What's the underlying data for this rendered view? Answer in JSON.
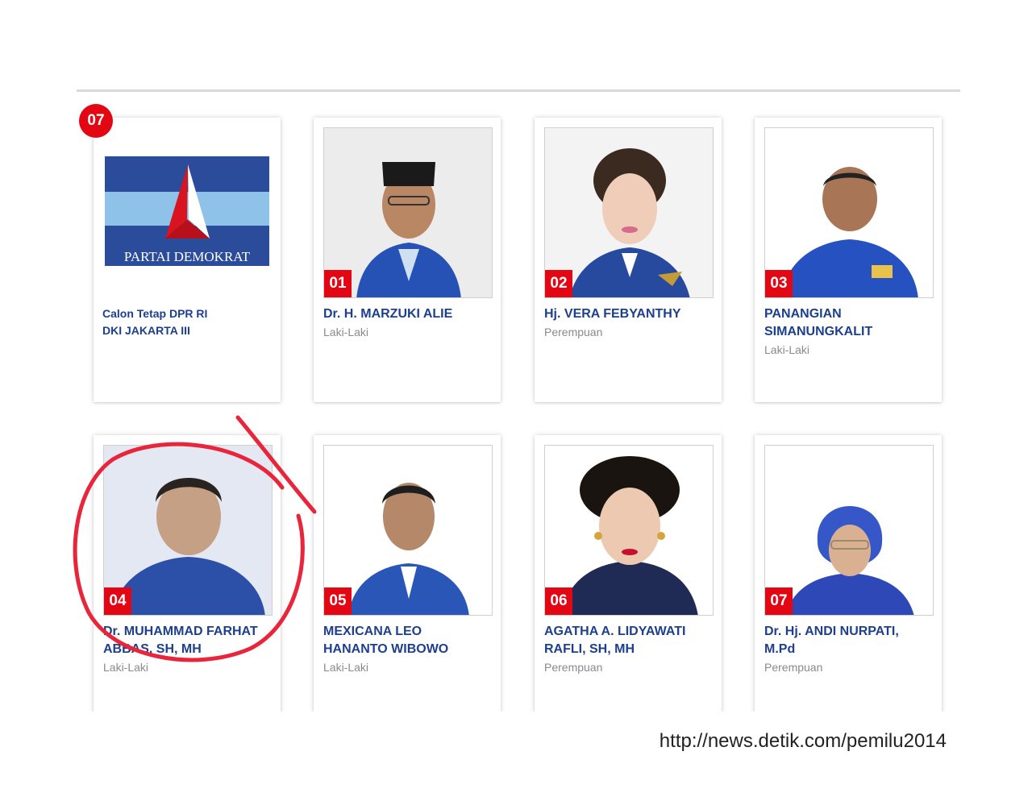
{
  "party": {
    "badge_number": "07",
    "logo_text": "PARTAI DEMOKRAT",
    "title_line1": "Calon Tetap DPR RI",
    "title_line2": "DKI JAKARTA III"
  },
  "candidates": [
    {
      "number": "01",
      "name_line1": "Dr. H. MARZUKI ALIE",
      "name_line2": "",
      "gender": "Laki-Laki"
    },
    {
      "number": "02",
      "name_line1": "Hj. VERA FEBYANTHY",
      "name_line2": "",
      "gender": "Perempuan"
    },
    {
      "number": "03",
      "name_line1": "PANANGIAN",
      "name_line2": "SIMANUNGKALIT",
      "gender": "Laki-Laki"
    },
    {
      "number": "04",
      "name_line1": "Dr. MUHAMMAD FARHAT",
      "name_line2": "ABBAS, SH, MH",
      "gender": "Laki-Laki"
    },
    {
      "number": "05",
      "name_line1": "MEXICANA LEO",
      "name_line2": "HANANTO WIBOWO",
      "gender": "Laki-Laki"
    },
    {
      "number": "06",
      "name_line1": "AGATHA A. LIDYAWATI",
      "name_line2": "RAFLI, SH, MH",
      "gender": "Perempuan"
    },
    {
      "number": "07",
      "name_line1": "Dr. Hj. ANDI NURPATI,",
      "name_line2": "M.Pd",
      "gender": "Perempuan"
    }
  ],
  "source_url": "http://news.detik.com/pemilu2014",
  "colors": {
    "accent_red": "#e30613",
    "name_blue": "#1d3f8c",
    "party_blue": "#2a4c9a"
  }
}
